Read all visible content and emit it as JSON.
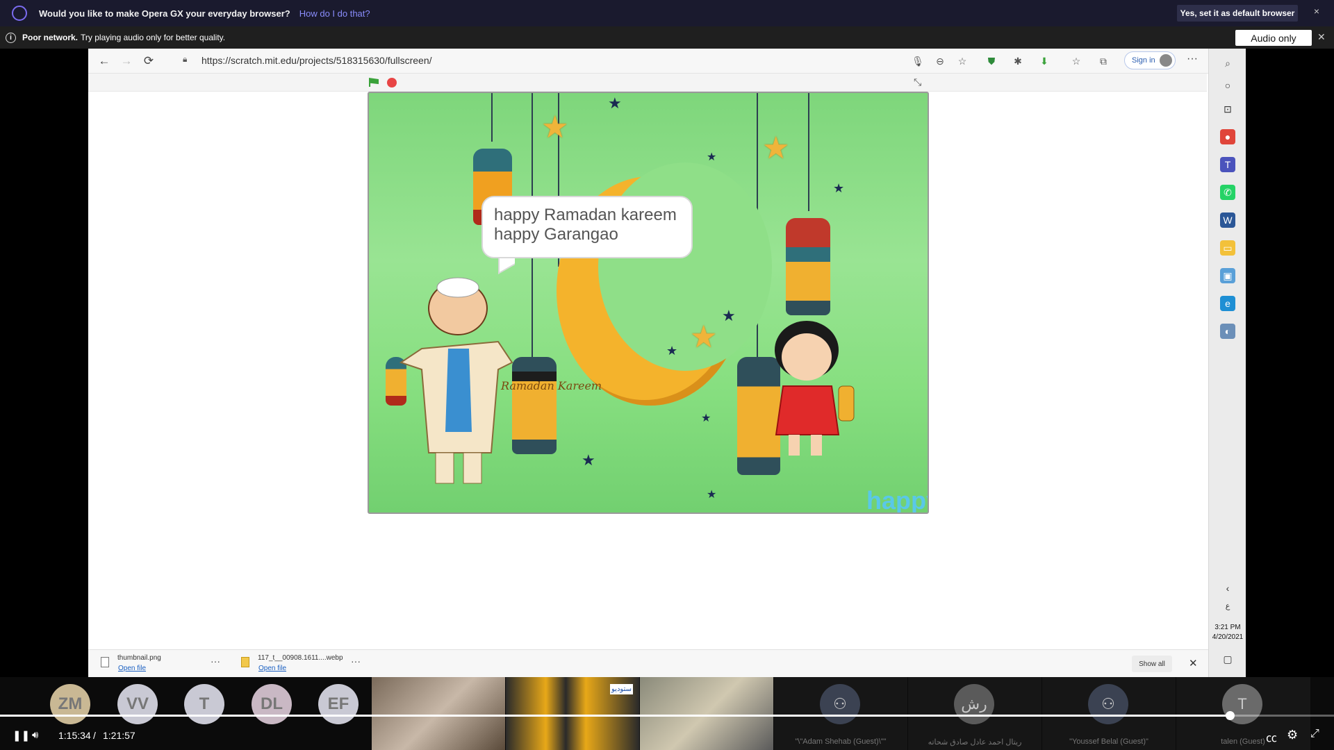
{
  "opera_banner": {
    "question": "Would you like to make Opera GX your everyday browser?",
    "how_link": "How do I do that?",
    "default_button": "Yes, set it as default browser",
    "close": "×"
  },
  "network_banner": {
    "title": "Poor network.",
    "message": "Try playing audio only for better quality.",
    "audio_only_button": "Audio only",
    "close": "✕",
    "info_icon": "i"
  },
  "browser": {
    "url": "https://scratch.mit.edu/projects/518315630/fullscreen/",
    "sign_in": "Sign in",
    "more": "···",
    "back": "←",
    "forward": "→",
    "refresh": "⟳"
  },
  "stage": {
    "speech_line_1": "happy Ramadan kareem",
    "speech_line_2": "happy Garangao",
    "ramadan_kareem_label": "Ramadan Kareem",
    "watermark": "happy"
  },
  "downloads": {
    "items": [
      {
        "name": "thumbnail.png",
        "action": "Open file"
      },
      {
        "name": "117_t__00908.1611....webp",
        "action": "Open file"
      }
    ],
    "show_all": "Show all",
    "close": "✕"
  },
  "taskbar": {
    "time": "3:21 PM",
    "date": "4/20/2021",
    "lang": "ع"
  },
  "participants": {
    "initials": [
      "ZM",
      "VV",
      "T",
      "DL",
      "EF"
    ],
    "guests": [
      {
        "name": "\"\\\"Adam Shehab (Guest)\\\"\"",
        "avatar": "person"
      },
      {
        "name": "ريتال احمد عادل صادق شحاته",
        "avatar": "رش"
      },
      {
        "name": "\"Youssef Belal (Guest)\"",
        "avatar": "person"
      },
      {
        "name": "talen (Guest)",
        "avatar": "T"
      }
    ],
    "video_logo": "ستوديو"
  },
  "player": {
    "current_time": "1:15:34",
    "separator": "/",
    "total_time": "1:21:57",
    "progress": 0.922
  },
  "colors": {
    "opera_accent": "#7b6cf0",
    "link_blue": "#8a8dfc",
    "stage_green": "#8fdf88",
    "moon_gold": "#f4b32c"
  },
  "icons": [
    "opera-logo-icon",
    "info-icon",
    "back-icon",
    "forward-icon",
    "refresh-icon",
    "lock-icon",
    "mic-icon",
    "zoom-icon",
    "favorite-icon",
    "shield-icon",
    "extension-icon",
    "download-icon",
    "collections-icon",
    "tabs-icon",
    "green-flag-icon",
    "stop-icon",
    "fullscreen-exit-icon",
    "pause-icon",
    "volume-icon",
    "captions-icon",
    "settings-icon",
    "expand-icon"
  ]
}
